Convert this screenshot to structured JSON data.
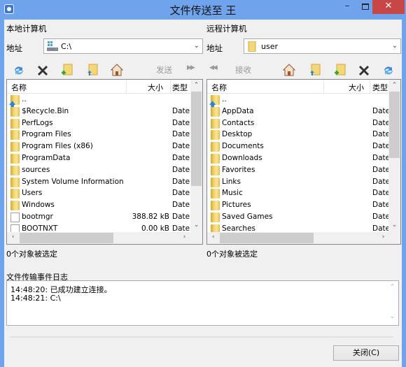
{
  "window": {
    "title": "文件传送至 王",
    "minimize_label": "–",
    "close_label": "✕"
  },
  "local": {
    "section_title": "本地计算机",
    "address_label": "地址",
    "address_value": "C:\\",
    "address_icon": "drive-icon",
    "toolbar": {
      "refresh": "refresh-icon",
      "delete": "delete-icon",
      "new_folder": "new-folder-icon",
      "up_folder": "parent-folder-icon",
      "home": "home-icon",
      "send_label": "发送",
      "send_arrow": "▶▶"
    },
    "columns": {
      "name": "名称",
      "size": "大小",
      "type": "类型"
    },
    "rows": [
      {
        "name": "..",
        "size": "",
        "type": "",
        "icon": "parent-folder"
      },
      {
        "name": "$Recycle.Bin",
        "size": "",
        "type": "Date",
        "icon": "folder"
      },
      {
        "name": "PerfLogs",
        "size": "",
        "type": "Date",
        "icon": "folder"
      },
      {
        "name": "Program Files",
        "size": "",
        "type": "Date",
        "icon": "folder"
      },
      {
        "name": "Program Files (x86)",
        "size": "",
        "type": "Date",
        "icon": "folder"
      },
      {
        "name": "ProgramData",
        "size": "",
        "type": "Date",
        "icon": "folder"
      },
      {
        "name": "sources",
        "size": "",
        "type": "Date",
        "icon": "folder"
      },
      {
        "name": "System Volume Information",
        "size": "",
        "type": "Date",
        "icon": "folder"
      },
      {
        "name": "Users",
        "size": "",
        "type": "Date",
        "icon": "folder"
      },
      {
        "name": "Windows",
        "size": "",
        "type": "Date",
        "icon": "folder"
      },
      {
        "name": "bootmgr",
        "size": "388.82 kB",
        "type": "Date",
        "icon": "file"
      },
      {
        "name": "BOOTNXT",
        "size": "0.00 kB",
        "type": "Date",
        "icon": "file"
      }
    ],
    "status": "0个对象被选定"
  },
  "remote": {
    "section_title": "远程计算机",
    "address_label": "地址",
    "address_value": "user",
    "address_icon": "folder-icon",
    "toolbar": {
      "receive_arrow": "◀◀",
      "receive_label": "接收",
      "home": "home-icon",
      "up_folder": "parent-folder-icon",
      "new_folder": "new-folder-icon",
      "delete": "delete-icon",
      "refresh": "refresh-icon"
    },
    "columns": {
      "name": "名称",
      "size": "大小",
      "type": "类型"
    },
    "rows": [
      {
        "name": "..",
        "size": "",
        "type": "",
        "icon": "parent-folder"
      },
      {
        "name": "AppData",
        "size": "",
        "type": "Date",
        "icon": "folder"
      },
      {
        "name": "Contacts",
        "size": "",
        "type": "Date",
        "icon": "folder"
      },
      {
        "name": "Desktop",
        "size": "",
        "type": "Date",
        "icon": "folder"
      },
      {
        "name": "Documents",
        "size": "",
        "type": "Date",
        "icon": "folder"
      },
      {
        "name": "Downloads",
        "size": "",
        "type": "Date",
        "icon": "folder"
      },
      {
        "name": "Favorites",
        "size": "",
        "type": "Date",
        "icon": "folder"
      },
      {
        "name": "Links",
        "size": "",
        "type": "Date",
        "icon": "folder"
      },
      {
        "name": "Music",
        "size": "",
        "type": "Date",
        "icon": "folder"
      },
      {
        "name": "Pictures",
        "size": "",
        "type": "Date",
        "icon": "folder"
      },
      {
        "name": "Saved Games",
        "size": "",
        "type": "Date",
        "icon": "folder"
      },
      {
        "name": "Searches",
        "size": "",
        "type": "Date",
        "icon": "folder"
      }
    ],
    "status": "0个对象被选定"
  },
  "log": {
    "title": "文件传输事件日志",
    "lines": [
      "14:48:20: 已成功建立连接。",
      "14:48:21: C:\\"
    ]
  },
  "close_button": "关闭(C)",
  "colors": {
    "titlebar": "#6fa3ec",
    "close_button": "#c74646",
    "panel_bg": "#f0f0f0",
    "folder": "#f6d971"
  }
}
